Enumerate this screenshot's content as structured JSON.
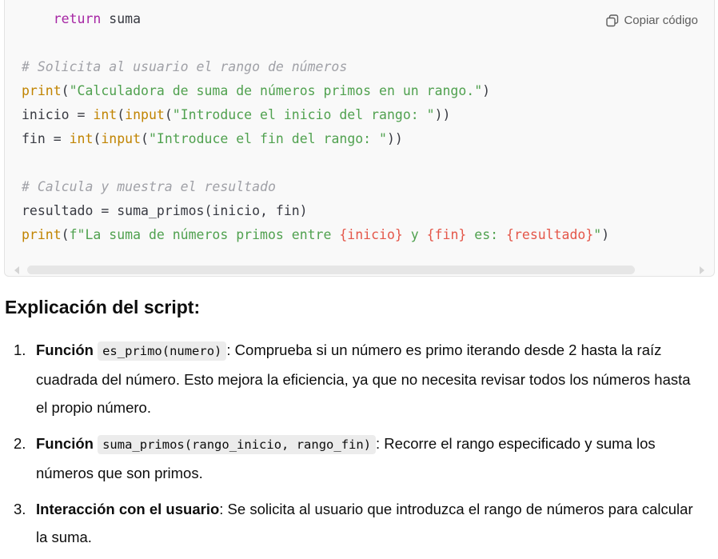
{
  "code_block": {
    "copy_label": "Copiar código",
    "lines": {
      "l1_kw": "return",
      "l1_rest": " suma",
      "l3_comment": "# Solicita al usuario el rango de números",
      "l4_fn": "print",
      "l4_p1": "(",
      "l4_str": "\"Calculadora de suma de números primos en un rango.\"",
      "l4_p2": ")",
      "l5_pre": "inicio = ",
      "l5_fn1": "int",
      "l5_p1": "(",
      "l5_fn2": "input",
      "l5_p2": "(",
      "l5_str": "\"Introduce el inicio del rango: \"",
      "l5_p3": "))",
      "l6_pre": "fin = ",
      "l6_fn1": "int",
      "l6_p1": "(",
      "l6_fn2": "input",
      "l6_p2": "(",
      "l6_str": "\"Introduce el fin del rango: \"",
      "l6_p3": "))",
      "l8_comment": "# Calcula y muestra el resultado",
      "l9": "resultado = suma_primos(inicio, fin)",
      "l10_fn": "print",
      "l10_p1": "(",
      "l10_s1": "f\"La suma de números primos entre ",
      "l10_v1": "{inicio}",
      "l10_s2": " y ",
      "l10_v2": "{fin}",
      "l10_s3": " es: ",
      "l10_v3": "{resultado}",
      "l10_s4": "\"",
      "l10_p2": ")"
    }
  },
  "explanation": {
    "title": "Explicación del script:",
    "items": [
      {
        "num": "1.",
        "bold": "Función",
        "code": "es_primo(numero)",
        "text": ": Comprueba si un número es primo iterando desde 2 hasta la raíz cuadrada del número. Esto mejora la eficiencia, ya que no necesita revisar todos los números hasta el propio número."
      },
      {
        "num": "2.",
        "bold": "Función",
        "code": "suma_primos(rango_inicio, rango_fin)",
        "text": ": Recorre el rango especificado y suma los números que son primos."
      },
      {
        "num": "3.",
        "bold": "Interacción con el usuario",
        "text": ": Se solicita al usuario que introduzca el rango de números para calcular la suma."
      }
    ]
  },
  "colors": {
    "keyword": "#a626a4",
    "function": "#c18401",
    "string": "#50a14f",
    "comment": "#a0a1a7",
    "interpolation": "#e45649"
  }
}
